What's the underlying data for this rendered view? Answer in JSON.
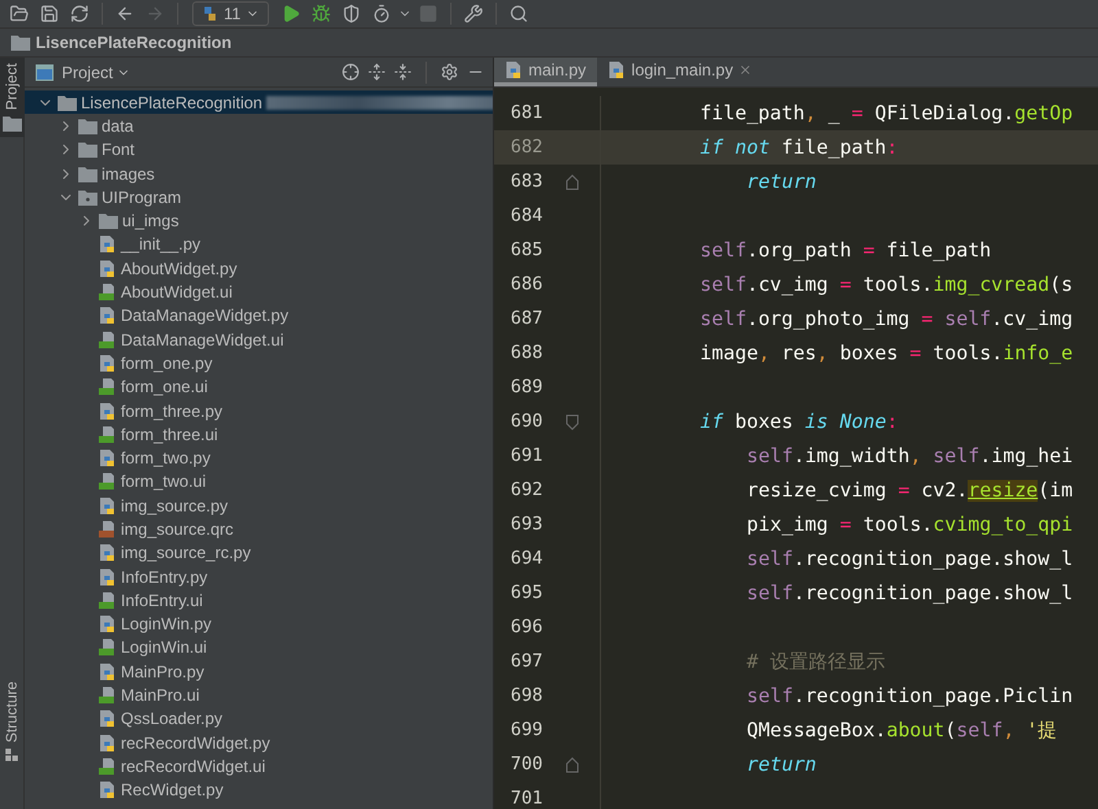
{
  "toolbar": {
    "buttons": [
      {
        "kind": "open",
        "disabled": false
      },
      {
        "kind": "save",
        "disabled": false
      },
      {
        "kind": "sync",
        "disabled": false
      },
      {
        "kind": "back",
        "disabled": false
      },
      {
        "kind": "forward",
        "disabled": true
      }
    ],
    "run_config": {
      "label": "11"
    },
    "run_buttons": [
      {
        "kind": "run",
        "disabled": false
      },
      {
        "kind": "debug",
        "disabled": false
      },
      {
        "kind": "coverage",
        "disabled": false
      },
      {
        "kind": "profile",
        "disabled": false
      },
      {
        "kind": "stop",
        "disabled": true
      }
    ]
  },
  "breadcrumb": {
    "label": "LisencePlateRecognition"
  },
  "side_stripe": {
    "tabs": [
      {
        "label": "Project",
        "selected": true
      },
      {
        "label": "Structure",
        "selected": false
      }
    ]
  },
  "project_panel": {
    "title": "Project",
    "tree": [
      {
        "label": "LisencePlateRecognition",
        "kind": "folder",
        "expanded": true,
        "selected": true,
        "children": [
          {
            "label": "data",
            "kind": "folder",
            "expanded": false,
            "selected": false
          },
          {
            "label": "Font",
            "kind": "folder",
            "expanded": false,
            "selected": false
          },
          {
            "label": "images",
            "kind": "folder",
            "expanded": false,
            "selected": false
          },
          {
            "label": "UIProgram",
            "kind": "package",
            "expanded": true,
            "selected": false,
            "children": [
              {
                "label": "ui_imgs",
                "kind": "folder",
                "expanded": false,
                "selected": false
              },
              {
                "label": "__init__.py",
                "kind": "py",
                "selected": false
              },
              {
                "label": "AboutWidget.py",
                "kind": "py",
                "selected": false
              },
              {
                "label": "AboutWidget.ui",
                "kind": "ui",
                "selected": false
              },
              {
                "label": "DataManageWidget.py",
                "kind": "py",
                "selected": false
              },
              {
                "label": "DataManageWidget.ui",
                "kind": "ui",
                "selected": false
              },
              {
                "label": "form_one.py",
                "kind": "py",
                "selected": false
              },
              {
                "label": "form_one.ui",
                "kind": "ui",
                "selected": false
              },
              {
                "label": "form_three.py",
                "kind": "py",
                "selected": false
              },
              {
                "label": "form_three.ui",
                "kind": "ui",
                "selected": false
              },
              {
                "label": "form_two.py",
                "kind": "py",
                "selected": false
              },
              {
                "label": "form_two.ui",
                "kind": "ui",
                "selected": false
              },
              {
                "label": "img_source.py",
                "kind": "py",
                "selected": false
              },
              {
                "label": "img_source.qrc",
                "kind": "qrc",
                "selected": false
              },
              {
                "label": "img_source_rc.py",
                "kind": "py",
                "selected": false
              },
              {
                "label": "InfoEntry.py",
                "kind": "py",
                "selected": false
              },
              {
                "label": "InfoEntry.ui",
                "kind": "ui",
                "selected": false
              },
              {
                "label": "LoginWin.py",
                "kind": "py",
                "selected": false
              },
              {
                "label": "LoginWin.ui",
                "kind": "ui",
                "selected": false
              },
              {
                "label": "MainPro.py",
                "kind": "py",
                "selected": false
              },
              {
                "label": "MainPro.ui",
                "kind": "ui",
                "selected": false
              },
              {
                "label": "QssLoader.py",
                "kind": "py",
                "selected": false
              },
              {
                "label": "recRecordWidget.py",
                "kind": "py",
                "selected": false
              },
              {
                "label": "recRecordWidget.ui",
                "kind": "ui",
                "selected": false
              },
              {
                "label": "RecWidget.py",
                "kind": "py",
                "selected": false
              }
            ]
          }
        ]
      }
    ]
  },
  "editor": {
    "tabs": [
      {
        "label": "main.py",
        "selected": true,
        "closable": false
      },
      {
        "label": "login_main.py",
        "selected": false,
        "closable": true
      }
    ],
    "lines": [
      {
        "number": "681",
        "current": false,
        "tokens": [
          {
            "kind": "plain",
            "text": "file_path"
          },
          {
            "kind": "punct",
            "text": ","
          },
          {
            "kind": "plain",
            "text": " _ "
          },
          {
            "kind": "operator",
            "text": "="
          },
          {
            "kind": "plain",
            "text": " QFileDialog."
          },
          {
            "kind": "call",
            "text": "getOp"
          }
        ]
      },
      {
        "number": "682",
        "current": true,
        "tokens": [
          {
            "kind": "keyword",
            "text": "if"
          },
          {
            "kind": "keyword",
            "text": " not"
          },
          {
            "kind": "plain",
            "text": " file_path"
          },
          {
            "kind": "operator",
            "text": ":"
          }
        ],
        "children": [
          {
            "number": "683",
            "current": false,
            "tokens": [
              {
                "kind": "keyword",
                "text": "return"
              }
            ]
          }
        ]
      },
      {
        "number": "684",
        "current": false
      },
      {
        "number": "685",
        "current": false,
        "tokens": [
          {
            "kind": "self",
            "text": "self"
          },
          {
            "kind": "plain",
            "text": ".org_path "
          },
          {
            "kind": "operator",
            "text": "="
          },
          {
            "kind": "plain",
            "text": " file_path"
          }
        ]
      },
      {
        "number": "686",
        "current": false,
        "tokens": [
          {
            "kind": "self",
            "text": "self"
          },
          {
            "kind": "plain",
            "text": ".cv_img "
          },
          {
            "kind": "operator",
            "text": "="
          },
          {
            "kind": "plain",
            "text": " tools."
          },
          {
            "kind": "call",
            "text": "img_cvread"
          },
          {
            "kind": "plain",
            "text": "(s"
          }
        ]
      },
      {
        "number": "687",
        "current": false,
        "tokens": [
          {
            "kind": "self",
            "text": "self"
          },
          {
            "kind": "plain",
            "text": ".org_photo_img "
          },
          {
            "kind": "operator",
            "text": "="
          },
          {
            "kind": "self",
            "text": " self"
          },
          {
            "kind": "plain",
            "text": ".cv_img"
          }
        ]
      },
      {
        "number": "688",
        "current": false,
        "tokens": [
          {
            "kind": "plain",
            "text": "image"
          },
          {
            "kind": "punct",
            "text": ","
          },
          {
            "kind": "plain",
            "text": " res"
          },
          {
            "kind": "punct",
            "text": ","
          },
          {
            "kind": "plain",
            "text": " boxes "
          },
          {
            "kind": "operator",
            "text": "="
          },
          {
            "kind": "plain",
            "text": " tools."
          },
          {
            "kind": "call",
            "text": "info_e"
          }
        ]
      },
      {
        "number": "689",
        "current": false
      },
      {
        "number": "690",
        "current": false,
        "tokens": [
          {
            "kind": "keyword",
            "text": "if"
          },
          {
            "kind": "plain",
            "text": " boxes "
          },
          {
            "kind": "keyword",
            "text": "is"
          },
          {
            "kind": "keyword",
            "text": " None"
          },
          {
            "kind": "operator",
            "text": ":"
          }
        ],
        "children": [
          {
            "number": "691",
            "current": false,
            "tokens": [
              {
                "kind": "self",
                "text": "self"
              },
              {
                "kind": "plain",
                "text": ".img_width"
              },
              {
                "kind": "punct",
                "text": ","
              },
              {
                "kind": "self",
                "text": " self"
              },
              {
                "kind": "plain",
                "text": ".img_hei"
              }
            ]
          },
          {
            "number": "692",
            "current": false,
            "tokens": [
              {
                "kind": "plain",
                "text": "resize_cvimg "
              },
              {
                "kind": "operator",
                "text": "="
              },
              {
                "kind": "plain",
                "text": " cv2."
              },
              {
                "kind": "marked_call",
                "text": "resize"
              },
              {
                "kind": "plain",
                "text": "(im"
              }
            ]
          },
          {
            "number": "693",
            "current": false,
            "tokens": [
              {
                "kind": "plain",
                "text": "pix_img "
              },
              {
                "kind": "operator",
                "text": "="
              },
              {
                "kind": "plain",
                "text": " tools."
              },
              {
                "kind": "call",
                "text": "cvimg_to_qpi"
              }
            ]
          },
          {
            "number": "694",
            "current": false,
            "tokens": [
              {
                "kind": "self",
                "text": "self"
              },
              {
                "kind": "plain",
                "text": ".recognition_page.show_l"
              }
            ]
          },
          {
            "number": "695",
            "current": false,
            "tokens": [
              {
                "kind": "self",
                "text": "self"
              },
              {
                "kind": "plain",
                "text": ".recognition_page.show_l"
              }
            ]
          },
          {
            "number": "696",
            "current": false
          },
          {
            "number": "697",
            "current": false,
            "tokens": [
              {
                "kind": "comment",
                "text": "# 设置路径显示"
              }
            ]
          },
          {
            "number": "698",
            "current": false,
            "tokens": [
              {
                "kind": "self",
                "text": "self"
              },
              {
                "kind": "plain",
                "text": ".recognition_page.Piclin"
              }
            ]
          },
          {
            "number": "699",
            "current": false,
            "tokens": [
              {
                "kind": "plain",
                "text": "QMessageBox."
              },
              {
                "kind": "call",
                "text": "about"
              },
              {
                "kind": "plain",
                "text": "("
              },
              {
                "kind": "self",
                "text": "self"
              },
              {
                "kind": "punct",
                "text": ","
              },
              {
                "kind": "string",
                "text": " '提"
              }
            ]
          },
          {
            "number": "700",
            "current": false,
            "tokens": [
              {
                "kind": "keyword",
                "text": "return"
              }
            ]
          }
        ]
      },
      {
        "number": "701",
        "current": false
      }
    ]
  }
}
